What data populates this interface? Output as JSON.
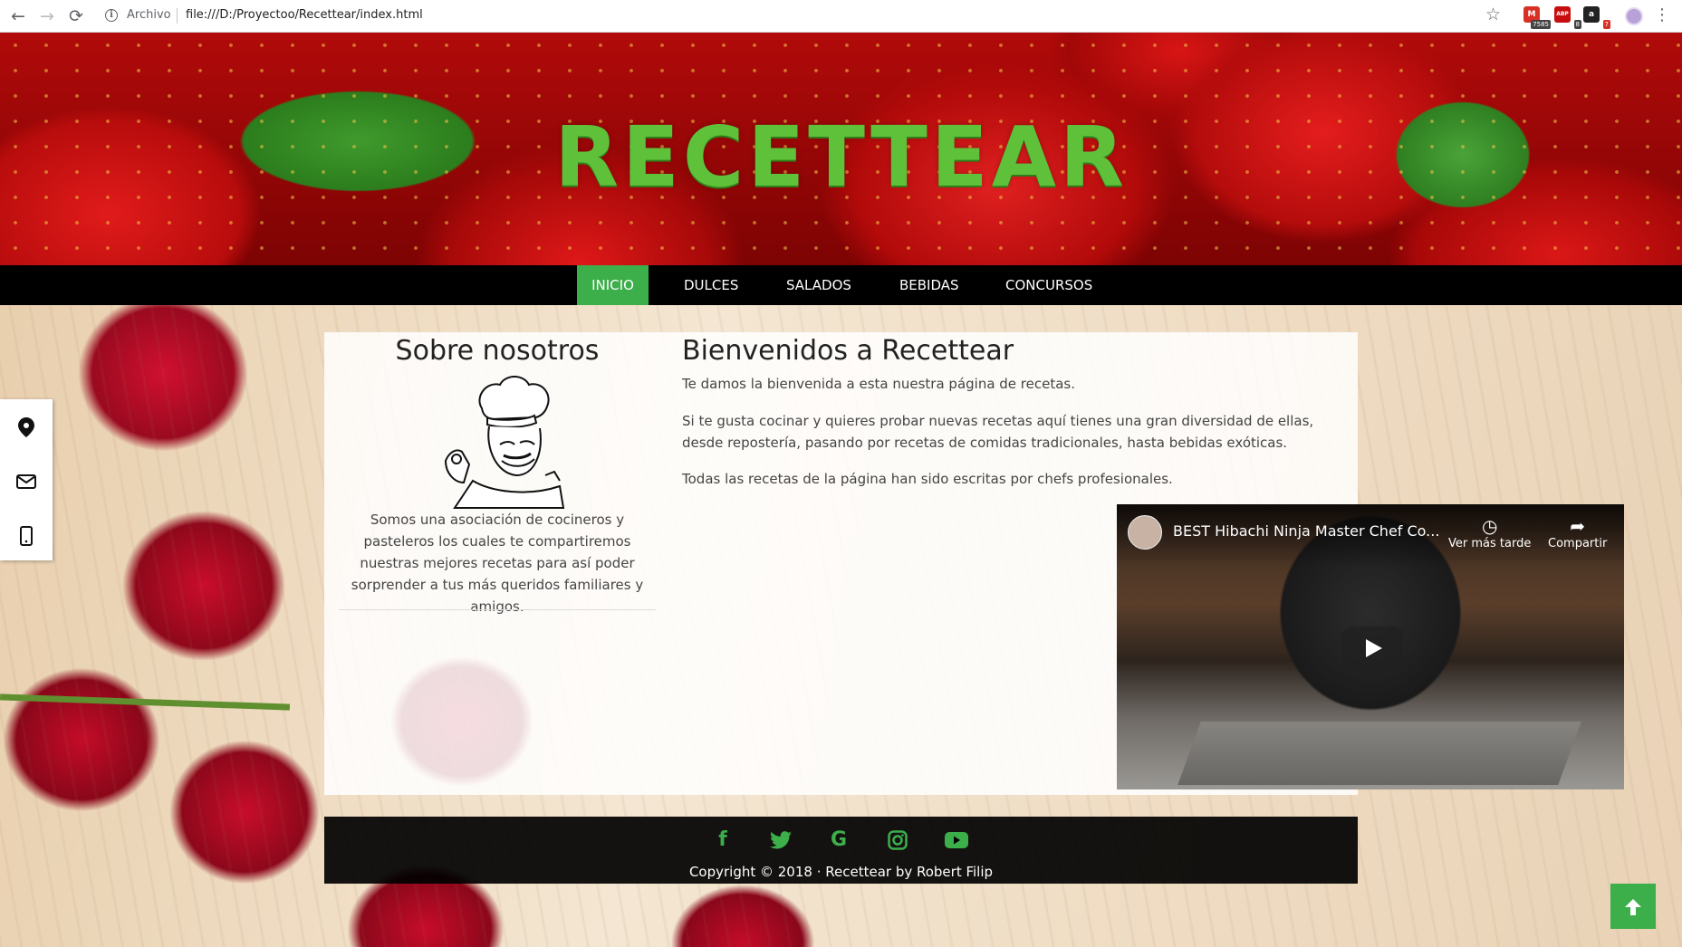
{
  "browser": {
    "back_icon": "←",
    "forward_icon": "→",
    "reload_icon": "⟳",
    "scheme_label": "Archivo",
    "url": "file:///D:/Proyectoo/Recettear/index.html",
    "star_icon": "☆",
    "menu_icon": "⋮",
    "extensions": [
      {
        "name": "gmail-extension-icon",
        "label": "M",
        "badge": "7585",
        "color": "#d93025"
      },
      {
        "name": "adblock-extension-icon",
        "label": "ABP",
        "badge": "8",
        "color": "#c70d0d"
      },
      {
        "name": "amazon-extension-icon",
        "label": "a",
        "badge": "7",
        "color": "#222222"
      }
    ]
  },
  "header": {
    "title": "RECETTEAR"
  },
  "nav": {
    "items": [
      {
        "label": "INICIO",
        "active": true
      },
      {
        "label": "DULCES",
        "active": false
      },
      {
        "label": "SALADOS",
        "active": false
      },
      {
        "label": "BEBIDAS",
        "active": false
      },
      {
        "label": "CONCURSOS",
        "active": false
      }
    ],
    "accent_color": "#3cae4a"
  },
  "side_contact": {
    "icons": [
      "map-marker-icon",
      "envelope-icon",
      "mobile-phone-icon"
    ]
  },
  "about": {
    "title": "Sobre nosotros",
    "text": "Somos una asociación de cocineros y pasteleros los cuales te compartiremos nuestras mejores recetas para así poder sorprender a tus más queridos familiares y amigos."
  },
  "welcome": {
    "title": "Bienvenidos a Recettear",
    "paragraphs": [
      "Te damos la bienvenida a esta nuestra página de recetas.",
      "Si te gusta cocinar y quieres probar nuevas recetas aquí tienes una gran diversidad de ellas, desde repostería, pasando por recetas de comidas tradicionales, hasta bebidas exóticas.",
      "Todas las recetas de la página han sido escritas por chefs profesionales."
    ]
  },
  "video": {
    "title": "BEST Hibachi Ninja Master Chef Co...",
    "watch_later": "Ver más tarde",
    "share": "Compartir"
  },
  "footer": {
    "social": [
      "facebook-icon",
      "twitter-icon",
      "google-icon",
      "instagram-icon",
      "youtube-icon"
    ],
    "copyright": "Copyright © 2018 · Recettear by Robert Filip"
  },
  "back_to_top_icon": "arrow-up-icon"
}
